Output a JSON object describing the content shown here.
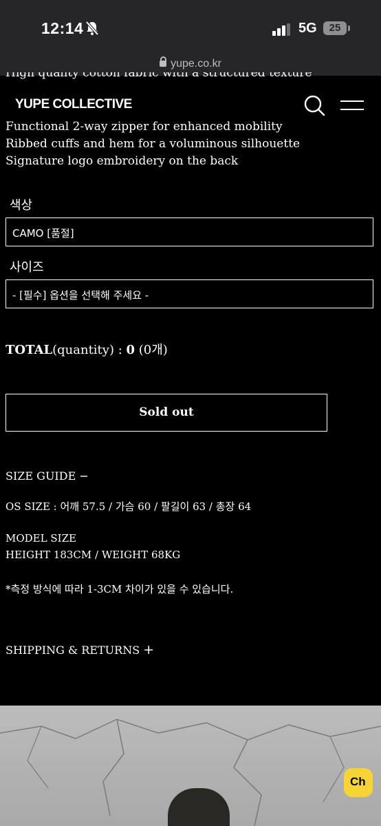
{
  "status": {
    "time": "12:14",
    "network": "5G",
    "battery": "25"
  },
  "browser": {
    "url": "yupe.co.kr"
  },
  "header": {
    "logo": "YUPE COLLECTIVE",
    "peek_text": "High quality cotton fabric with a structured texture"
  },
  "features": [
    "Functional 2-way zipper for enhanced mobility",
    "Ribbed cuffs and hem for a voluminous silhouette",
    "Signature logo embroidery on the back"
  ],
  "options": {
    "color_label": "색상",
    "color_value": "CAMO [품절]",
    "size_label": "사이즈",
    "size_value": "- [필수] 옵션을 선택해 주세요 -"
  },
  "total": {
    "label": "TOTAL",
    "text": "(quantity) : ",
    "count": "0",
    "paren": " (0개)"
  },
  "buttons": {
    "sold_out": "Sold out"
  },
  "size_guide": {
    "title": "SIZE GUIDE",
    "toggle": "−",
    "os_size": "OS SIZE : 어깨 57.5 / 가슴 60 / 팔길이 63 / 총장 64",
    "model_title": "MODEL SIZE",
    "model_size": "HEIGHT 183CM / WEIGHT 68KG",
    "note": "*측정 방식에 따라 1-3CM 차이가 있을 수 있습니다."
  },
  "shipping": {
    "title": "SHIPPING & RETURNS",
    "toggle": "+"
  },
  "chat_button": "Ch"
}
